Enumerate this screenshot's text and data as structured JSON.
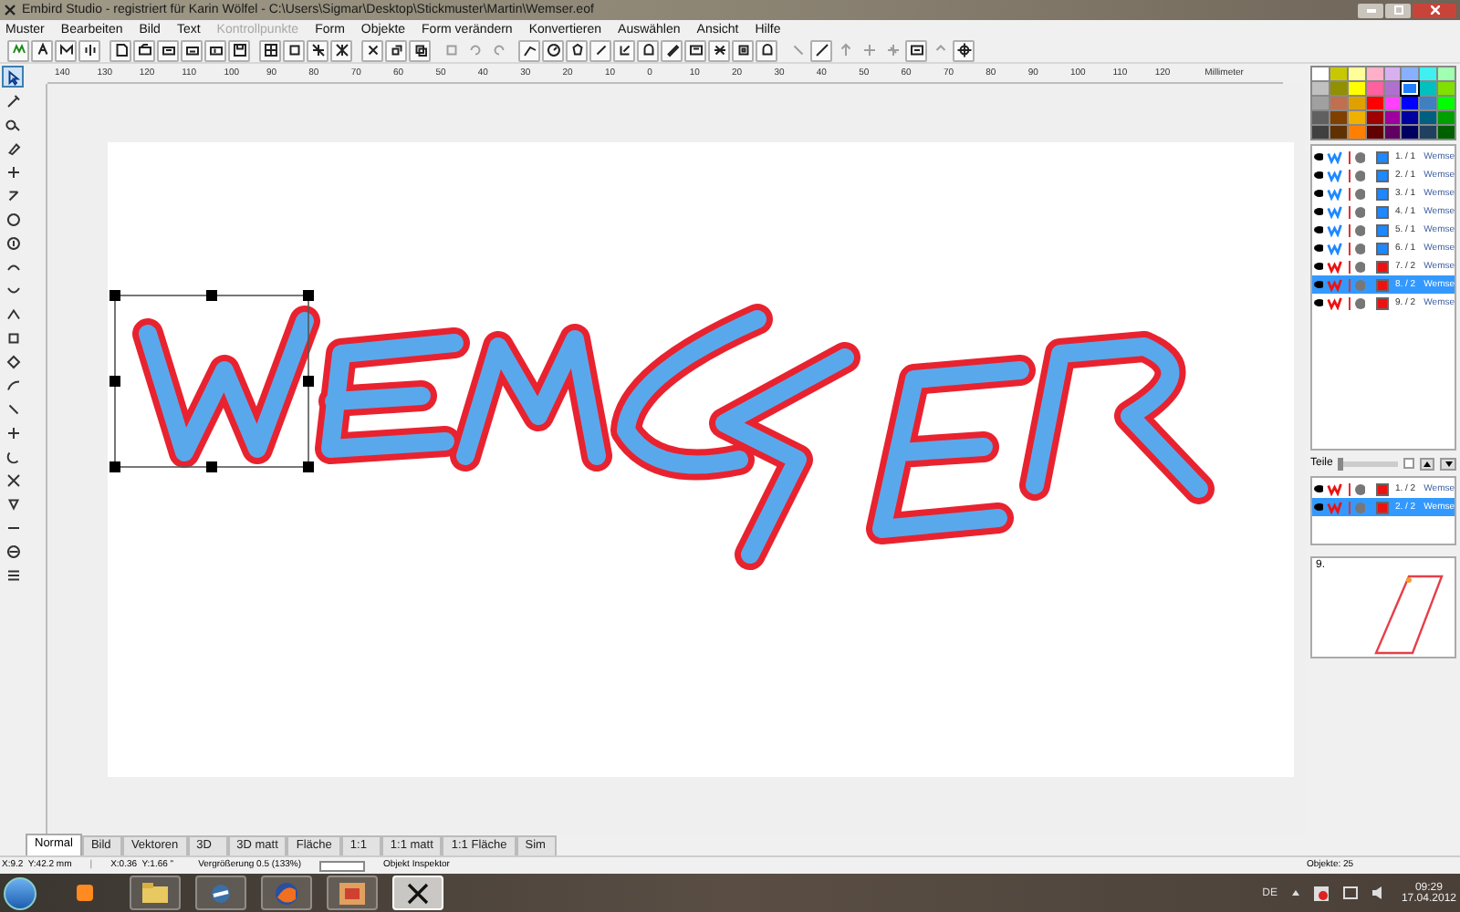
{
  "window": {
    "title": "Embird Studio - registriert für Karin Wölfel - C:\\Users\\Sigmar\\Desktop\\Stickmuster\\Martin\\Wemser.eof"
  },
  "menu": [
    {
      "label": "Muster",
      "disabled": false
    },
    {
      "label": "Bearbeiten",
      "disabled": false
    },
    {
      "label": "Bild",
      "disabled": false
    },
    {
      "label": "Text",
      "disabled": false
    },
    {
      "label": "Kontrollpunkte",
      "disabled": true
    },
    {
      "label": "Form",
      "disabled": false
    },
    {
      "label": "Objekte",
      "disabled": false
    },
    {
      "label": "Form verändern",
      "disabled": false
    },
    {
      "label": "Konvertieren",
      "disabled": false
    },
    {
      "label": "Auswählen",
      "disabled": false
    },
    {
      "label": "Ansicht",
      "disabled": false
    },
    {
      "label": "Hilfe",
      "disabled": false
    }
  ],
  "toolbar": [
    {
      "disabled": false
    },
    {
      "disabled": false
    },
    {
      "disabled": false
    },
    {
      "disabled": false
    },
    {
      "disabled": false
    },
    {
      "disabled": false
    },
    {
      "disabled": false
    },
    {
      "disabled": false
    },
    {
      "disabled": false
    },
    {
      "disabled": false
    },
    {
      "disabled": false
    },
    {
      "disabled": false
    },
    {
      "disabled": false
    },
    {
      "disabled": false
    },
    {
      "disabled": false
    },
    {
      "disabled": false
    },
    {
      "disabled": false
    },
    {
      "disabled": true
    },
    {
      "disabled": true
    },
    {
      "disabled": true
    },
    {
      "disabled": false
    },
    {
      "disabled": false
    },
    {
      "disabled": false
    },
    {
      "disabled": false
    },
    {
      "disabled": false
    },
    {
      "disabled": false
    },
    {
      "disabled": false
    },
    {
      "disabled": false
    },
    {
      "disabled": false
    },
    {
      "disabled": false
    },
    {
      "disabled": false
    },
    {
      "disabled": true
    },
    {
      "disabled": false
    },
    {
      "disabled": true
    },
    {
      "disabled": true
    },
    {
      "disabled": true
    },
    {
      "disabled": false
    },
    {
      "disabled": true
    },
    {
      "disabled": false
    }
  ],
  "tools": [
    {
      "selected": true
    },
    {
      "selected": false
    },
    {
      "selected": false
    },
    {
      "selected": false
    },
    {
      "selected": false
    },
    {
      "selected": false
    },
    {
      "selected": false
    },
    {
      "selected": false
    },
    {
      "selected": false
    },
    {
      "selected": false
    },
    {
      "selected": false
    },
    {
      "selected": false
    },
    {
      "selected": false
    },
    {
      "selected": false
    },
    {
      "selected": false
    },
    {
      "selected": false
    },
    {
      "selected": false
    },
    {
      "selected": false
    },
    {
      "selected": false
    },
    {
      "selected": false
    },
    {
      "selected": false
    },
    {
      "selected": false
    }
  ],
  "ruler": {
    "labels": [
      "140",
      "130",
      "120",
      "110",
      "100",
      "90",
      "80",
      "70",
      "60",
      "50",
      "40",
      "30",
      "20",
      "10",
      "0",
      "10",
      "20",
      "30",
      "40",
      "50",
      "60",
      "70",
      "80",
      "90",
      "100",
      "110",
      "120"
    ],
    "unit": "Millimeter"
  },
  "palette": [
    {
      "color": "#ffffff",
      "selected": false
    },
    {
      "color": "#c8c800",
      "selected": false
    },
    {
      "color": "#ffff99",
      "selected": false
    },
    {
      "color": "#ffb0c8",
      "selected": false
    },
    {
      "color": "#d8b0f0",
      "selected": false
    },
    {
      "color": "#88b0ff",
      "selected": false
    },
    {
      "color": "#40f0f0",
      "selected": false
    },
    {
      "color": "#a0ffb0",
      "selected": false
    },
    {
      "color": "#c0c0c0",
      "selected": false
    },
    {
      "color": "#909000",
      "selected": false
    },
    {
      "color": "#ffff00",
      "selected": false
    },
    {
      "color": "#ff60a0",
      "selected": false
    },
    {
      "color": "#b070d0",
      "selected": false
    },
    {
      "color": "#2080ff",
      "selected": true
    },
    {
      "color": "#00c0c0",
      "selected": false
    },
    {
      "color": "#80e000",
      "selected": false
    },
    {
      "color": "#a0a0a0",
      "selected": false
    },
    {
      "color": "#c07050",
      "selected": false
    },
    {
      "color": "#e0a000",
      "selected": false
    },
    {
      "color": "#ff0000",
      "selected": false
    },
    {
      "color": "#ff40ff",
      "selected": false
    },
    {
      "color": "#0000ff",
      "selected": false
    },
    {
      "color": "#4080c0",
      "selected": false
    },
    {
      "color": "#00ff00",
      "selected": false
    },
    {
      "color": "#606060",
      "selected": false
    },
    {
      "color": "#804000",
      "selected": false
    },
    {
      "color": "#f0b000",
      "selected": false
    },
    {
      "color": "#a00000",
      "selected": false
    },
    {
      "color": "#a000a0",
      "selected": false
    },
    {
      "color": "#0000a0",
      "selected": false
    },
    {
      "color": "#006080",
      "selected": false
    },
    {
      "color": "#00a000",
      "selected": false
    },
    {
      "color": "#404040",
      "selected": false
    },
    {
      "color": "#603000",
      "selected": false
    },
    {
      "color": "#ff8000",
      "selected": false
    },
    {
      "color": "#600000",
      "selected": false
    },
    {
      "color": "#600060",
      "selected": false
    },
    {
      "color": "#000060",
      "selected": false
    },
    {
      "color": "#204060",
      "selected": false
    },
    {
      "color": "#006000",
      "selected": false
    }
  ],
  "objects": [
    {
      "label": "1. / 1",
      "name": "Wemse",
      "color": "#1e88ff",
      "selected": false
    },
    {
      "label": "2. / 1",
      "name": "Wemse",
      "color": "#1e88ff",
      "selected": false
    },
    {
      "label": "3. / 1",
      "name": "Wemse",
      "color": "#1e88ff",
      "selected": false
    },
    {
      "label": "4. / 1",
      "name": "Wemse",
      "color": "#1e88ff",
      "selected": false
    },
    {
      "label": "5. / 1",
      "name": "Wemse",
      "color": "#1e88ff",
      "selected": false
    },
    {
      "label": "6. / 1",
      "name": "Wemse",
      "color": "#1e88ff",
      "selected": false
    },
    {
      "label": "7. / 2",
      "name": "Wemse",
      "color": "#ee1111",
      "selected": false
    },
    {
      "label": "8. / 2",
      "name": "Wemse",
      "color": "#ee1111",
      "selected": true
    },
    {
      "label": "9. / 2",
      "name": "Wemse",
      "color": "#ee1111",
      "selected": false
    }
  ],
  "parts": {
    "label": "Teile",
    "level": 0,
    "checked": false,
    "items": [
      {
        "label": "1. / 2",
        "name": "Wemse",
        "color": "#ee1111",
        "selected": false
      },
      {
        "label": "2. / 2",
        "name": "Wemse",
        "color": "#ee1111",
        "selected": true
      }
    ]
  },
  "preview": {
    "label": "9."
  },
  "view_tabs": [
    {
      "label": "Normal",
      "selected": true
    },
    {
      "label": "Bild",
      "selected": false
    },
    {
      "label": "Vektoren",
      "selected": false
    },
    {
      "label": "3D",
      "selected": false
    },
    {
      "label": "3D matt",
      "selected": false
    },
    {
      "label": "Fläche",
      "selected": false
    },
    {
      "label": "1:1",
      "selected": false
    },
    {
      "label": "1:1 matt",
      "selected": false
    },
    {
      "label": "1:1 Fläche",
      "selected": false
    },
    {
      "label": "Sim",
      "selected": false
    }
  ],
  "status_bar": {
    "position_mm": "X:9.2  Y:42.2 mm",
    "separator": "|",
    "position_in": "X:0.36  Y:1.66 \"",
    "zoom": "Vergrößerung 0.5 (133%)",
    "inspector": "Objekt Inspektor",
    "objects": "Objekte: 25"
  },
  "taskbar": {
    "language": "DE",
    "time": "09:29",
    "date": "17.04.2012"
  }
}
